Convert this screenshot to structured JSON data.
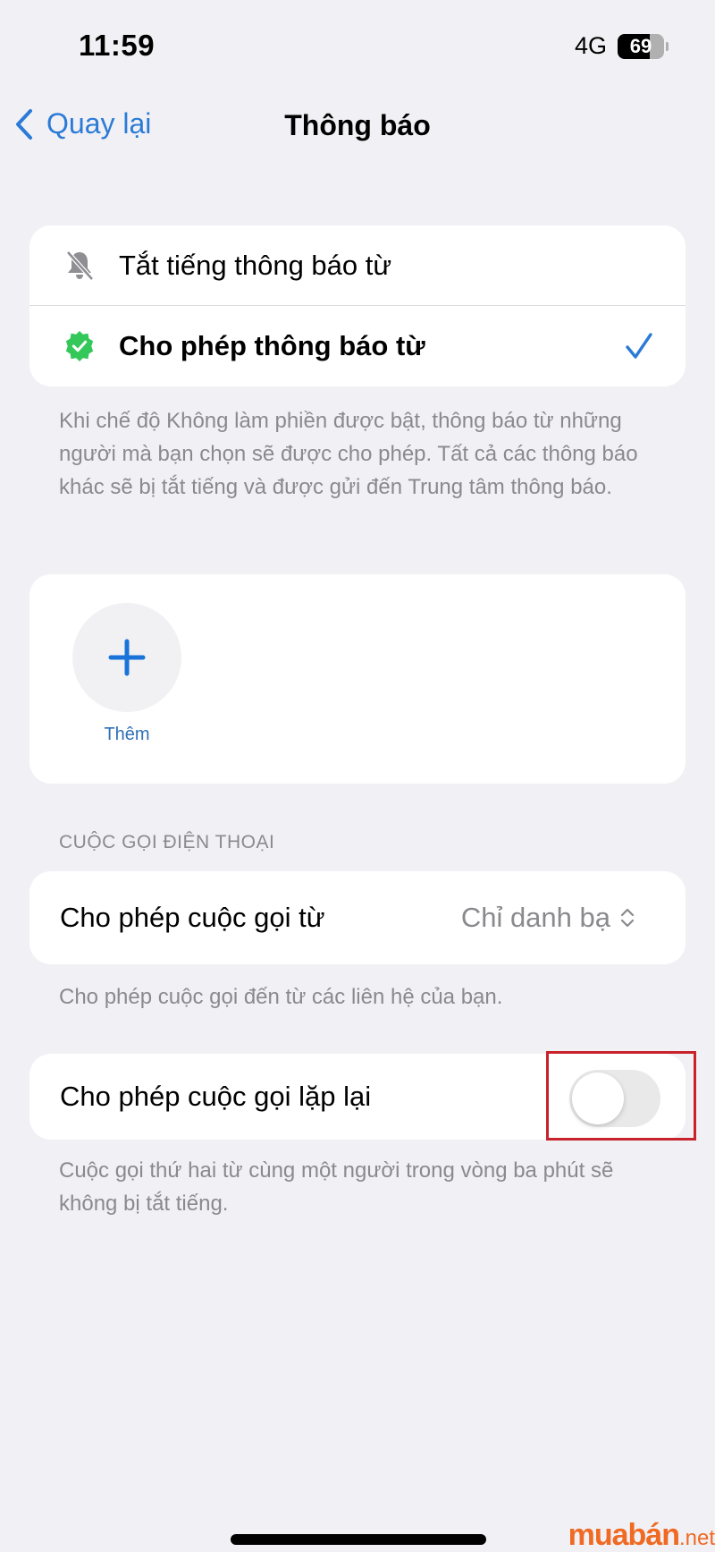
{
  "status_bar": {
    "time": "11:59",
    "network": "4G",
    "battery_percent": 69,
    "battery_label": "69",
    "signal_bars_active": 3,
    "signal_bars_total": 4
  },
  "nav": {
    "back_label": "Quay lại",
    "title": "Thông báo"
  },
  "mode_options": [
    {
      "label": "Tắt tiếng thông báo từ",
      "icon": "bell-slash-icon",
      "selected": false
    },
    {
      "label": "Cho phép thông báo từ",
      "icon": "verified-badge-icon",
      "selected": true
    }
  ],
  "mode_footnote": "Khi chế độ Không làm phiền được bật, thông báo từ những người mà bạn chọn sẽ được cho phép. Tất cả các thông báo khác sẽ bị tắt tiếng và được gửi đến Trung tâm thông báo.",
  "people": {
    "add_label": "Thêm"
  },
  "calls": {
    "section_header": "CUỘC GỌI ĐIỆN THOẠI",
    "allow_calls_label": "Cho phép cuộc gọi từ",
    "allow_calls_value": "Chỉ danh bạ",
    "allow_calls_footnote": "Cho phép cuộc gọi đến từ các liên hệ của bạn.",
    "repeat_calls_label": "Cho phép cuộc gọi lặp lại",
    "repeat_calls_enabled": false,
    "repeat_calls_footnote": "Cuộc gọi thứ hai từ cùng một người trong vòng ba phút sẽ không bị tắt tiếng."
  },
  "watermark": {
    "brand": "muabán",
    "tld": ".net"
  },
  "colors": {
    "accent": "#2b7bd6",
    "background": "#f1f1f5",
    "verified_green": "#34c759",
    "highlight_red": "#c8222c",
    "watermark_orange": "#f06a23"
  }
}
